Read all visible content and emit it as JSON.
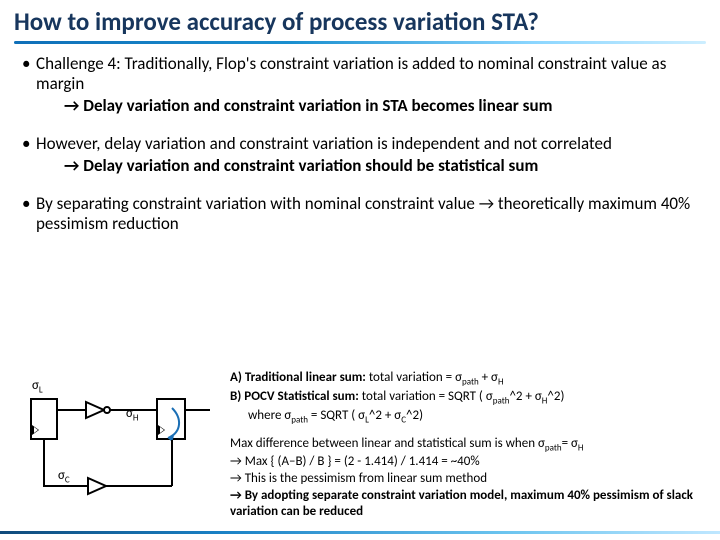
{
  "title": "How to improve accuracy of process variation STA?",
  "bullets": {
    "p1": "Challenge 4: Traditionally,  Flop's constraint variation is added to nominal constraint value as margin",
    "p1sub": "Delay variation and constraint variation in STA becomes linear sum",
    "p2": "However, delay variation and constraint variation is independent and not correlated",
    "p2sub": "Delay variation and constraint variation should be statistical sum",
    "p3": "By separating constraint variation with nominal constraint value → theoretically maximum 40% pessimism reduction"
  },
  "diagram": {
    "sigmaL": "σ",
    "sigmaL_sub": "L",
    "sigmaH": "σ",
    "sigmaH_sub": "H",
    "sigmaC": "σ",
    "sigmaC_sub": "C"
  },
  "math": {
    "a_label": "A) Traditional linear sum:",
    "a_body": " total variation = σ",
    "a_sub1": "path",
    "a_plus": " + σ",
    "a_sub2": "H",
    "b_label": "B) POCV Statistical sum:",
    "b_body": " total variation = SQRT ( σ",
    "b_sub1": "path",
    "b_rest": "^2 + σ",
    "b_sub2": "H",
    "b_tail": "^2)",
    "where": "where σ",
    "where_sub": "path",
    "where_eq": " = SQRT ( σ",
    "where_l": "L",
    "where_mid": "^2 + σ",
    "where_c": "C",
    "where_end": "^2)",
    "diff1a": "Max difference between linear and statistical sum is when σ",
    "diff1a_sub": "path",
    "diff1b": "= σ",
    "diff1b_sub": "H",
    "diff2": "→ Max { (A–B) / B } = (2 - 1.414) / 1.414 = ~40%",
    "diff3": "→ This is the pessimism from linear sum method",
    "diff4": "→ By adopting separate constraint variation model, maximum 40% pessimism of slack variation can be reduced"
  }
}
